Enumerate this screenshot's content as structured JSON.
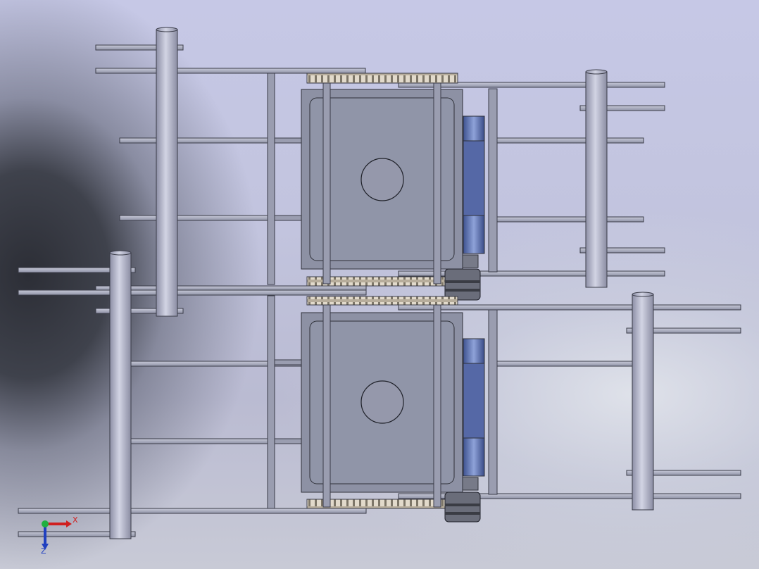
{
  "viewport": {
    "view": "cad-model",
    "colors": {
      "tube": "#a9abbf",
      "tube_light": "#cfd1e2",
      "frame": "#8f93a6",
      "frame_stroke": "#3a3c48",
      "chain": "#d8cfc0",
      "cylinder": "#5e72b0",
      "background_top": "#c6c8e6"
    }
  },
  "triad": {
    "x_label": "X",
    "z_label": "Z",
    "x_color": "#d02020",
    "y_color": "#20b040",
    "z_color": "#2040c0"
  }
}
